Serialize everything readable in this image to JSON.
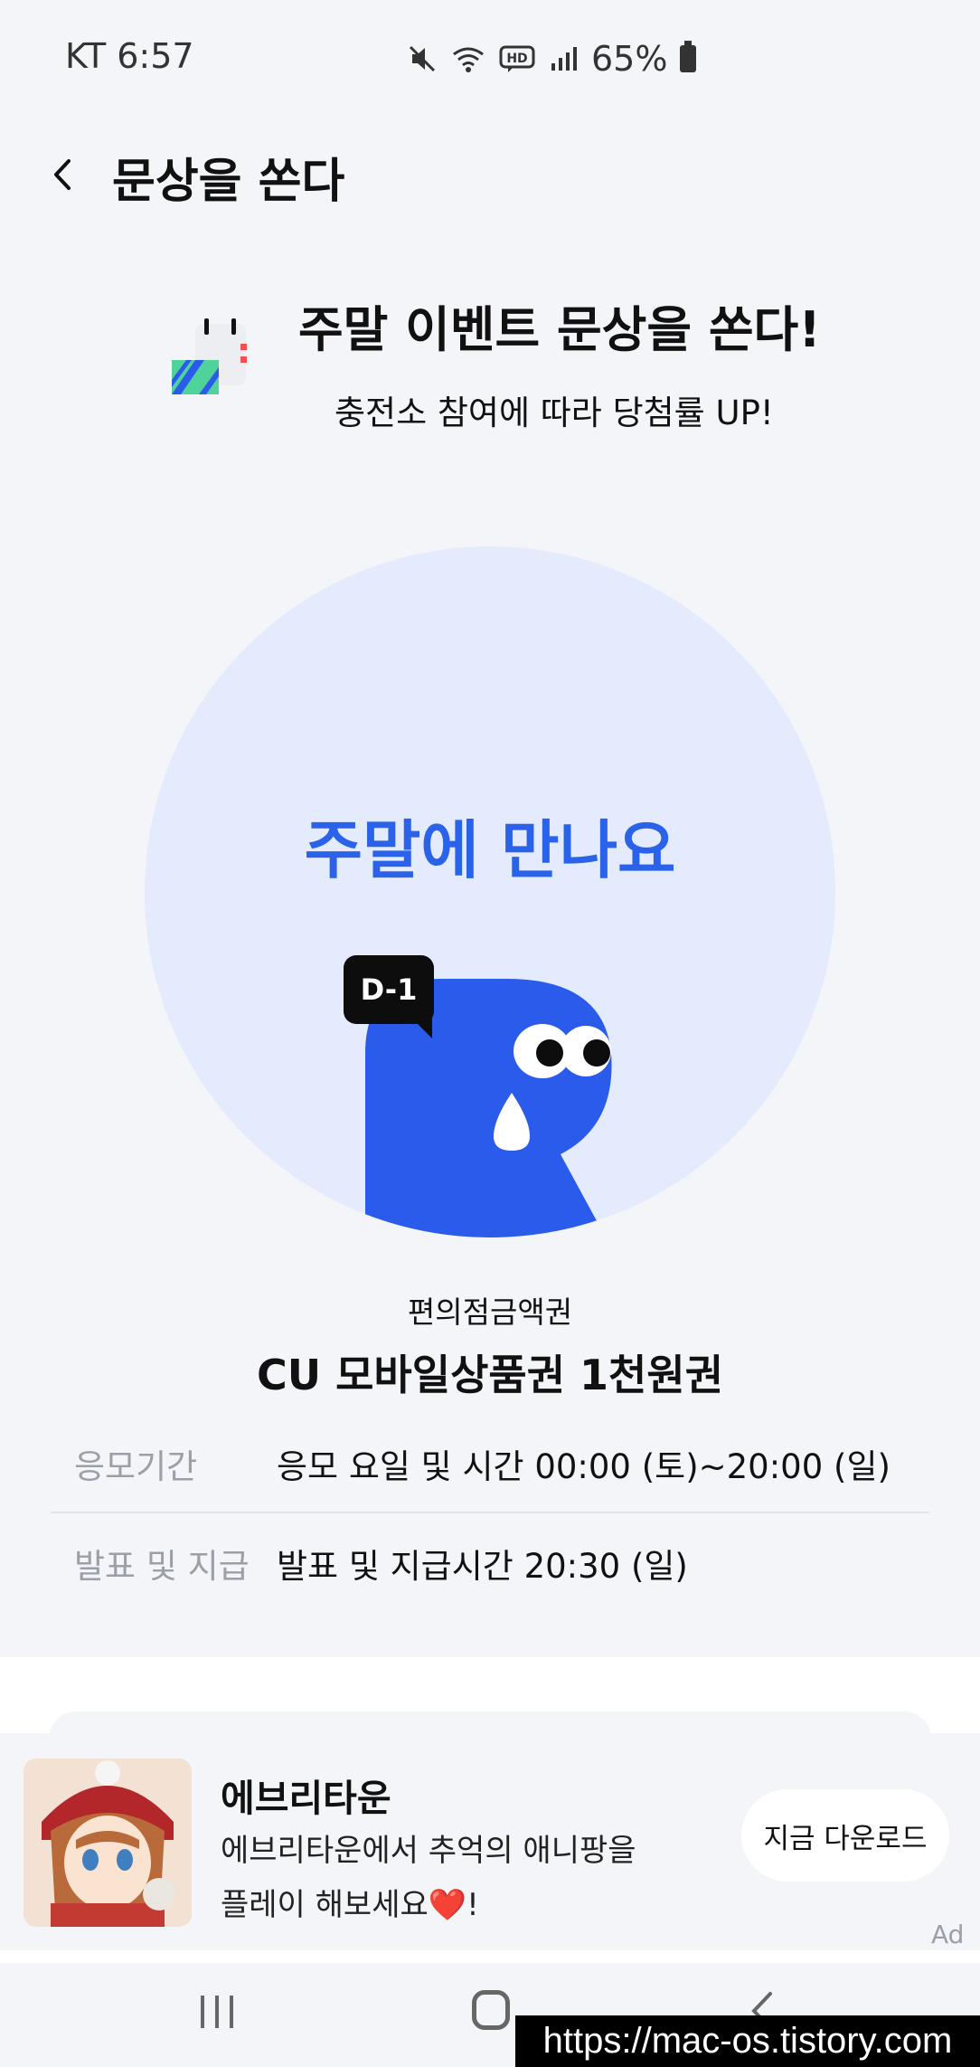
{
  "status_bar": {
    "carrier_time": "KT 6:57",
    "battery_pct": "65%",
    "icons": [
      "mute-icon",
      "wifi-icon",
      "hd-voice-icon",
      "signal-icon",
      "battery-icon"
    ]
  },
  "header": {
    "title": "문상을 쏜다",
    "back_icon": "chevron-left-icon"
  },
  "event": {
    "title": "주말 이벤트 문상을 쏜다!",
    "subtitle": "충전소 참여에 따라 당첨률 UP!",
    "icon": "calendar-icon"
  },
  "hero": {
    "text": "주말에 만나요",
    "badge": "D-1",
    "colors": {
      "circle": "#e4ebfd",
      "accent": "#2a62ea",
      "mascot": "#2a5bea"
    }
  },
  "product": {
    "category": "편의점금액권",
    "name": "CU 모바일상품권 1천원권"
  },
  "info": {
    "period_label": "응모기간",
    "period_value": "응모 요일 및 시간 00:00 (토)~20:00 (일)",
    "announce_label": "발표 및 지급",
    "announce_value": "발표 및 지급시간 20:30 (일)"
  },
  "ad": {
    "title": "에브리타운",
    "desc_line1": "에브리타운에서 추억의 애니팡을",
    "desc_line2": "플레이 해보세요",
    "heart": "❤️",
    "desc_end": "!",
    "cta": "지금 다운로드",
    "tag": "Ad"
  },
  "nav": {
    "icons": [
      "recent-apps-icon",
      "home-icon",
      "back-icon"
    ]
  },
  "watermark": "https://mac-os.tistory.com"
}
